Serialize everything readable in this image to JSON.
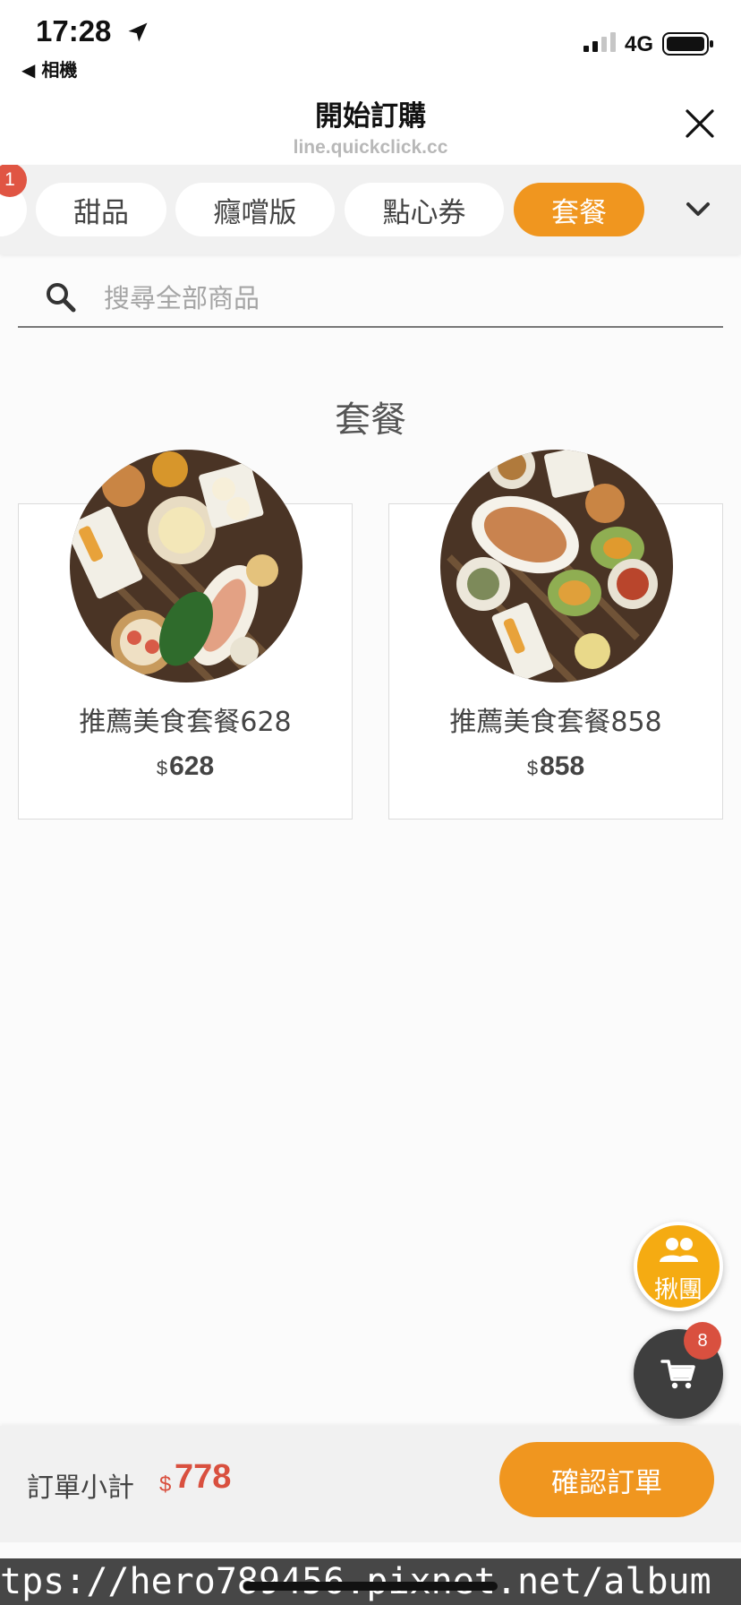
{
  "status_bar": {
    "time": "17:28",
    "back_label": "◀ 相機",
    "network": "4G"
  },
  "header": {
    "title": "開始訂購",
    "url": "line.quickclick.cc"
  },
  "tabs": {
    "partial_badge": "1",
    "items": [
      {
        "label": "甜品",
        "active": false
      },
      {
        "label": "癮嚐版",
        "active": false
      },
      {
        "label": "點心券",
        "active": false
      },
      {
        "label": "套餐",
        "active": true
      }
    ]
  },
  "search": {
    "placeholder": "搜尋全部商品"
  },
  "section": {
    "title": "套餐"
  },
  "products": [
    {
      "name": "推薦美食套餐628",
      "currency": "$",
      "price": "628"
    },
    {
      "name": "推薦美食套餐858",
      "currency": "$",
      "price": "858"
    }
  ],
  "fab": {
    "group_label": "揪團",
    "cart_count": "8"
  },
  "bottom_bar": {
    "subtotal_label": "訂單小計",
    "currency": "$",
    "subtotal": "778",
    "confirm_label": "確認訂單"
  },
  "watermark": {
    "text": "tps://hero789456.pixnet.net/album"
  },
  "colors": {
    "accent": "#f0961f",
    "badge": "#d9503f",
    "group_fab": "#f5ab12",
    "cart_fab": "#3e3e3e"
  }
}
